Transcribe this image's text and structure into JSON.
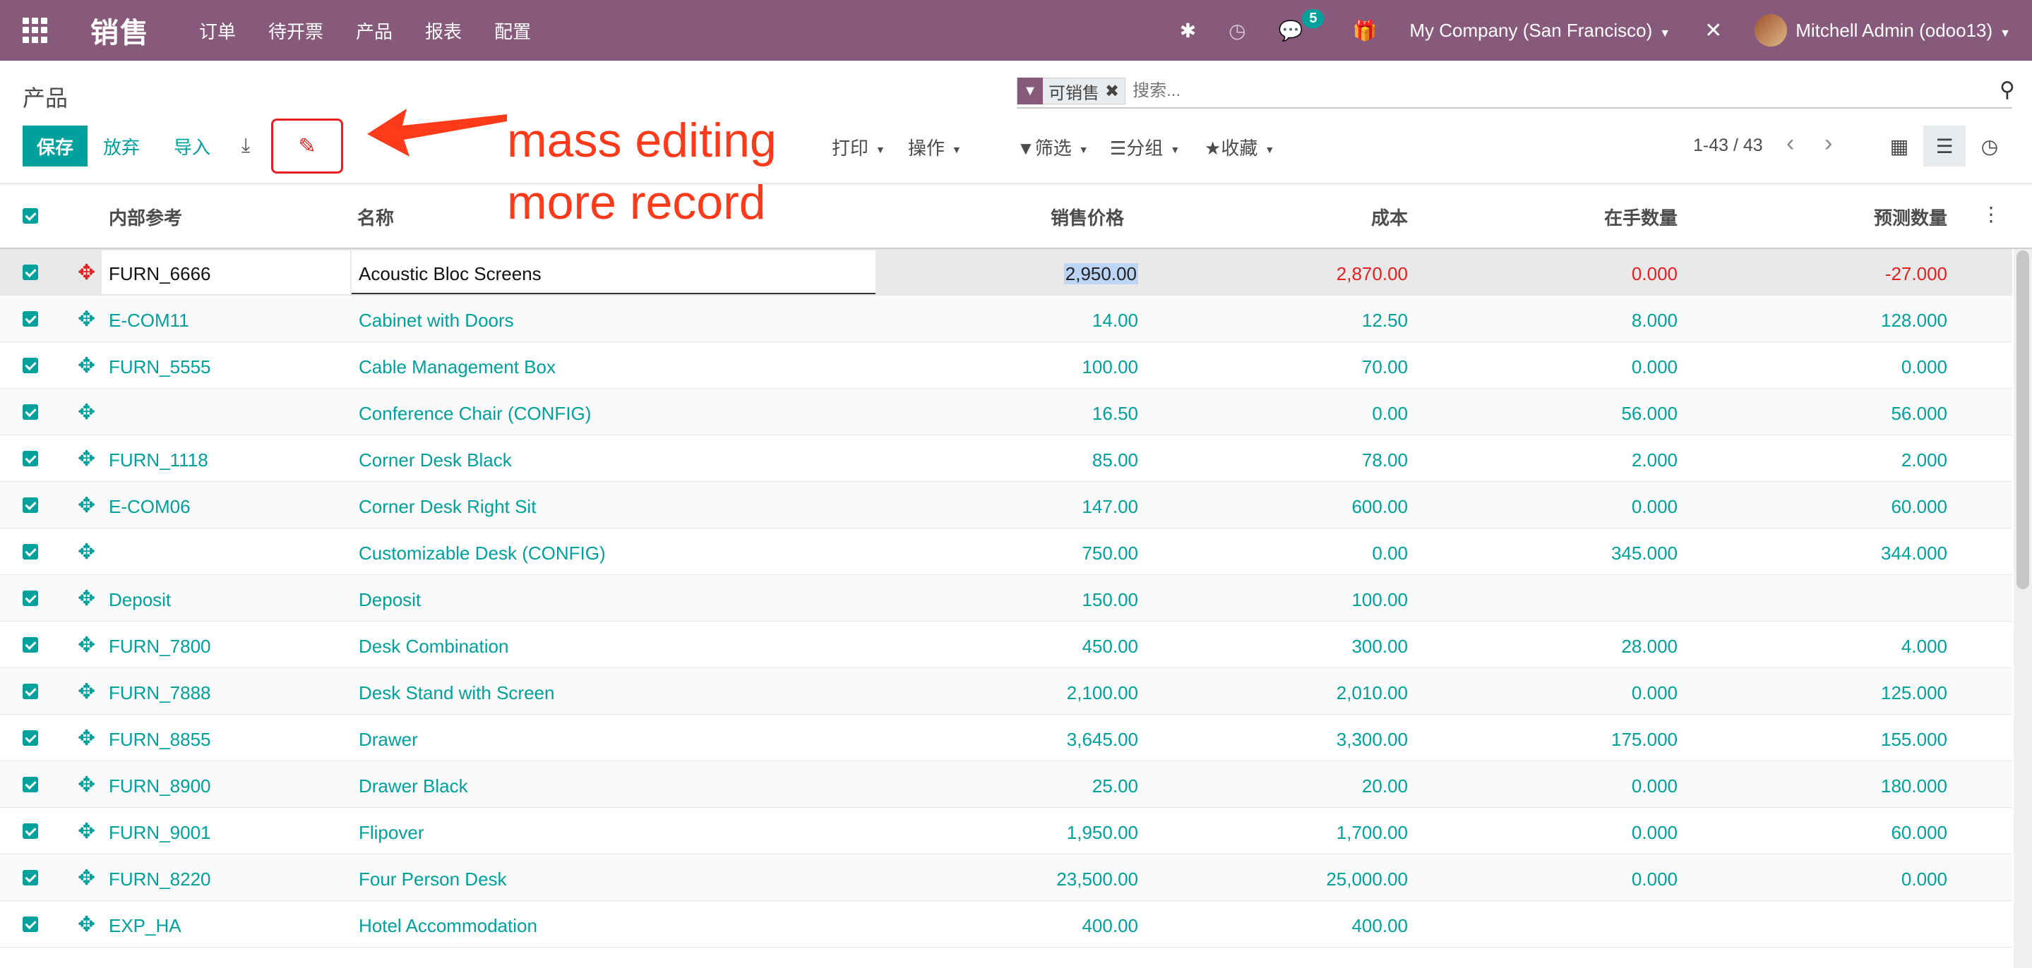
{
  "navbar": {
    "brand": "销售",
    "menu": [
      "订单",
      "待开票",
      "产品",
      "报表",
      "配置"
    ],
    "icons": [
      "bug-icon",
      "clock-icon",
      "chat-icon",
      "gift-icon"
    ],
    "message_count": "5",
    "company": "My Company (San Francisco)",
    "user": "Mitchell Admin (odoo13)"
  },
  "page": {
    "breadcrumb": "产品",
    "search_facet": "可销售",
    "search_placeholder": "搜索...",
    "save_label": "保存",
    "discard_label": "放弃",
    "import_label": "导入",
    "print_label": "打印",
    "action_label": "操作",
    "filter_label": "筛选",
    "group_label": "分组",
    "favorite_label": "收藏",
    "pager": "1-43 / 43"
  },
  "annotation": {
    "line1": "mass editing",
    "line2": "more record",
    "color": "#ff3a1a"
  },
  "table": {
    "columns": [
      "内部参考",
      "名称",
      "销售价格",
      "成本",
      "在手数量",
      "预测数量"
    ],
    "rows": [
      [
        "FURN_6666",
        "Acoustic Bloc Screens",
        "2,950.00",
        "2,870.00",
        "0.000",
        "-27.000"
      ],
      [
        "E-COM11",
        "Cabinet with Doors",
        "14.00",
        "12.50",
        "8.000",
        "128.000"
      ],
      [
        "FURN_5555",
        "Cable Management Box",
        "100.00",
        "70.00",
        "0.000",
        "0.000"
      ],
      [
        "",
        "Conference Chair (CONFIG)",
        "16.50",
        "0.00",
        "56.000",
        "56.000"
      ],
      [
        "FURN_1118",
        "Corner Desk Black",
        "85.00",
        "78.00",
        "2.000",
        "2.000"
      ],
      [
        "E-COM06",
        "Corner Desk Right Sit",
        "147.00",
        "600.00",
        "0.000",
        "60.000"
      ],
      [
        "",
        "Customizable Desk (CONFIG)",
        "750.00",
        "0.00",
        "345.000",
        "344.000"
      ],
      [
        "Deposit",
        "Deposit",
        "150.00",
        "100.00",
        "",
        ""
      ],
      [
        "FURN_7800",
        "Desk Combination",
        "450.00",
        "300.00",
        "28.000",
        "4.000"
      ],
      [
        "FURN_7888",
        "Desk Stand with Screen",
        "2,100.00",
        "2,010.00",
        "0.000",
        "125.000"
      ],
      [
        "FURN_8855",
        "Drawer",
        "3,645.00",
        "3,300.00",
        "175.000",
        "155.000"
      ],
      [
        "FURN_8900",
        "Drawer Black",
        "25.00",
        "20.00",
        "0.000",
        "180.000"
      ],
      [
        "FURN_9001",
        "Flipover",
        "1,950.00",
        "1,700.00",
        "0.000",
        "60.000"
      ],
      [
        "FURN_8220",
        "Four Person Desk",
        "23,500.00",
        "25,000.00",
        "0.000",
        "0.000"
      ],
      [
        "EXP_HA",
        "Hotel Accommodation",
        "400.00",
        "400.00",
        "",
        ""
      ]
    ]
  },
  "colors": {
    "navbar": "#875a7b",
    "accent": "#00a09d",
    "edit_highlight": "#e62020"
  }
}
